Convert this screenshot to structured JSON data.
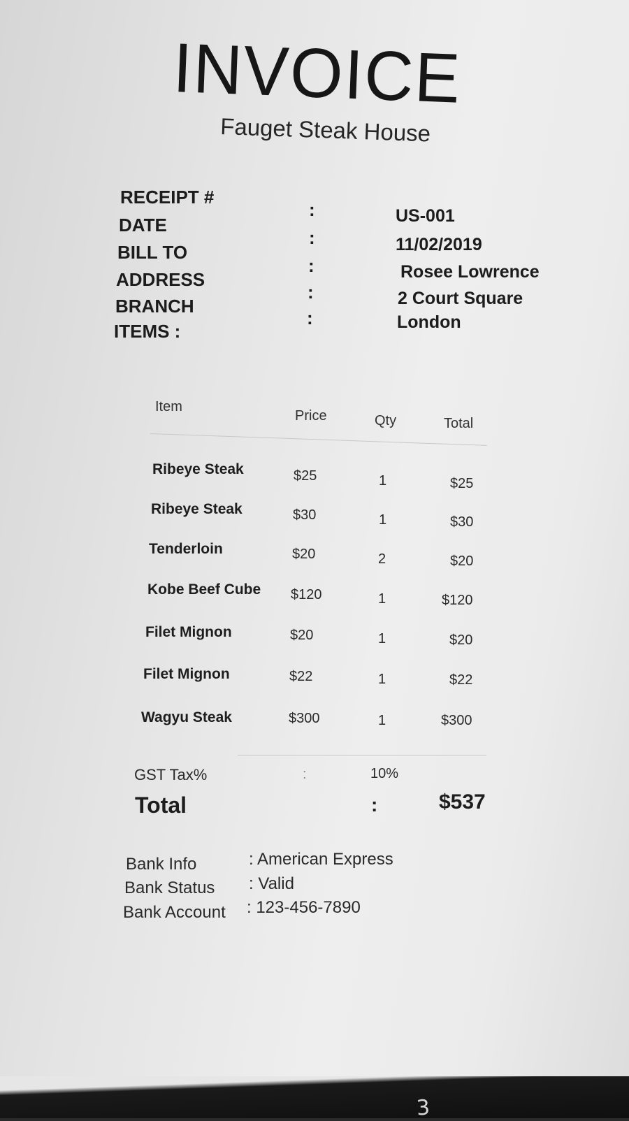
{
  "document": {
    "title": "INVOICE",
    "subtitle": "Fauget Steak House",
    "page_mark": "3"
  },
  "meta": {
    "receipt_label": "RECEIPT #",
    "date_label": "DATE",
    "bill_to_label": "BILL TO",
    "address_label": "ADDRESS",
    "branch_label": "BRANCH",
    "items_label": "ITEMS :",
    "colon": ":",
    "receipt_value": "US-001",
    "date_value": "11/02/2019",
    "bill_to_value": "Rosee Lowrence",
    "address_value": "2 Court Square",
    "branch_value": "London"
  },
  "table": {
    "headers": [
      "Item",
      "Price",
      "Qty",
      "Total"
    ],
    "rows": [
      {
        "item": "Ribeye Steak",
        "price": "$25",
        "qty": "1",
        "total": "$25"
      },
      {
        "item": "Ribeye Steak",
        "price": "$30",
        "qty": "1",
        "total": "$30"
      },
      {
        "item": "Tenderloin",
        "price": "$20",
        "qty": "2",
        "total": "$20"
      },
      {
        "item": "Kobe Beef Cube",
        "price": "$120",
        "qty": "1",
        "total": "$120"
      },
      {
        "item": "Filet Mignon",
        "price": "$20",
        "qty": "1",
        "total": "$20"
      },
      {
        "item": "Filet Mignon",
        "price": "$22",
        "qty": "1",
        "total": "$22"
      },
      {
        "item": "Wagyu Steak",
        "price": "$300",
        "qty": "1",
        "total": "$300"
      }
    ]
  },
  "summary": {
    "tax_label": "GST Tax%",
    "tax_colon": ":",
    "tax_value": "10%",
    "total_label": "Total",
    "total_colon": ":",
    "total_value": "$537"
  },
  "bank": {
    "info_label": "Bank Info",
    "info_value": ": American Express",
    "status_label": "Bank Status",
    "status_value": ": Valid",
    "account_label": "Bank Account",
    "account_value": ": 123-456-7890"
  }
}
